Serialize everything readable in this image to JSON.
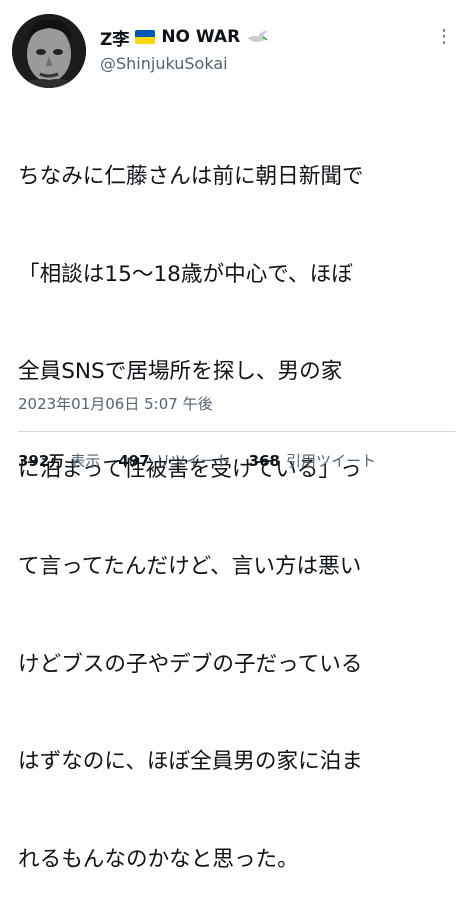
{
  "author": {
    "name": "Z李",
    "name_suffix": "NO WAR",
    "handle": "@ShinjukuSokai"
  },
  "tweet": {
    "lines": [
      "ちなみに仁藤さんは前に朝日新聞で",
      "「相談は15〜18歳が中心で、ほぼ",
      "全員SNSで居場所を探し、男の家",
      "に泊まって性被害を受けている」っ",
      "て言ってたんだけど、言い方は悪い",
      "けどブスの子やデブの子だっている",
      "はずなのに、ほぼ全員男の家に泊ま",
      "れるもんなのかなと思った。"
    ],
    "timestamp": "2023年01月06日 5:07 午後"
  },
  "stats": {
    "views_count": "392万",
    "views_label": "表示",
    "retweets_count": "497",
    "retweets_label": "リツイート",
    "quotes_count": "368",
    "quotes_label": "引用ツイート"
  },
  "icons": {
    "more": "more-options-icon",
    "flag": "ukraine-flag-icon",
    "dove": "dove-icon"
  },
  "colors": {
    "text": "#0f1419",
    "secondary": "#536471",
    "divider": "#cfd9de",
    "flag_blue": "#0057b7",
    "flag_yellow": "#ffd700"
  }
}
